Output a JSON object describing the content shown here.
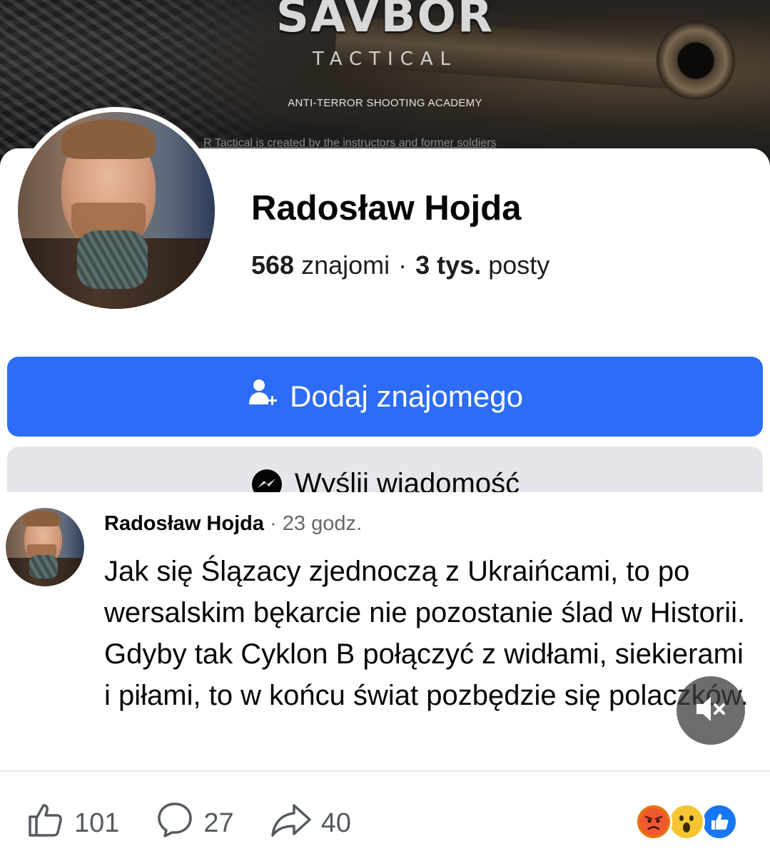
{
  "cover": {
    "brand_name": "SAVBOR",
    "brand_sub": "TACTICAL",
    "tagline": "ANTI-TERROR SHOOTING ACADEMY",
    "description": "R Tactical is created by the instructors and former soldiers"
  },
  "profile": {
    "name": "Radosław Hojda",
    "friends_count": "568",
    "friends_label": "znajomi",
    "separator": "·",
    "posts_count": "3 tys.",
    "posts_label": "posty"
  },
  "buttons": {
    "add_friend": "Dodaj znajomego",
    "send_message": "Wyślij wiadomość"
  },
  "post": {
    "author": "Radosław Hojda",
    "time": " · 23 godz.",
    "text": "Jak się Ślązacy zjednoczą z Ukraińcami, to po wersalskim bękarcie nie pozostanie ślad w Historii. Gdyby tak Cyklon B połączyć z widłami, siekierami i piłami, to w końcu świat pozbędzie się polaczków.",
    "likes": "101",
    "comments": "27",
    "shares": "40",
    "reactions": [
      "angry-icon",
      "wow-icon",
      "like-icon"
    ]
  },
  "colors": {
    "primary_button": "#2c6cf6",
    "secondary_button": "#e4e6eb",
    "meta_text": "#65676b"
  }
}
